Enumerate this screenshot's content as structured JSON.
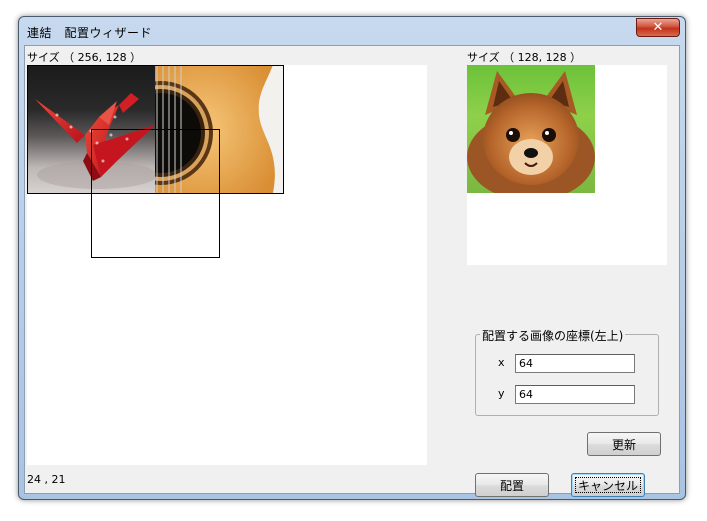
{
  "window": {
    "title": "連結　配置ウィザード"
  },
  "left_panel": {
    "size_label": "サイズ （ 256, 128 ）",
    "cursor_coords": "24 , 21"
  },
  "right_panel": {
    "size_label": "サイズ （ 128, 128 ）"
  },
  "placement": {
    "group_title": "配置する画像の座標(左上)",
    "x_label": "x",
    "x_value": "64",
    "y_label": "y",
    "y_value": "64"
  },
  "buttons": {
    "update": "更新",
    "place": "配置",
    "cancel": "キャンセル"
  },
  "icons": {
    "close": "close-icon"
  }
}
